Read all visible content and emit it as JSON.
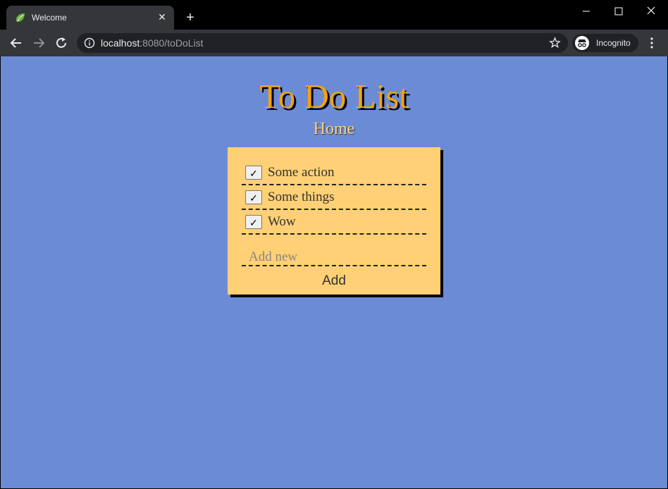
{
  "browser": {
    "tab": {
      "title": "Welcome",
      "favicon": "spring-leaf-icon"
    },
    "url": {
      "host": "localhost",
      "rest": ":8080/toDoList"
    },
    "profile_label": "Incognito",
    "colors": {
      "tabstrip": "#000000",
      "toolbar": "#35363a",
      "omnibox": "#202124"
    }
  },
  "page": {
    "title": "To Do List",
    "home_link": "Home",
    "todos": [
      {
        "label": "Some action",
        "checked": true
      },
      {
        "label": "Some things",
        "checked": true
      },
      {
        "label": "Wow",
        "checked": true
      }
    ],
    "check_glyph": "✓",
    "add_placeholder": "Add new",
    "add_button": "Add",
    "colors": {
      "background": "#6b8bd5",
      "title": "#f2a310",
      "card": "#ffd075"
    }
  }
}
